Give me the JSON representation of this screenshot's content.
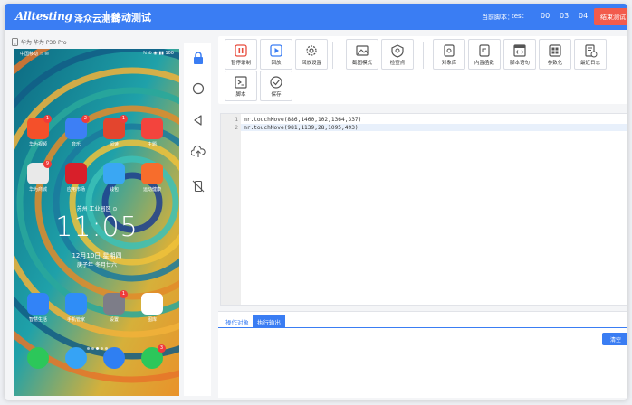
{
  "header": {
    "logo": "Alltesting",
    "logo_sub": "泽众云测试",
    "module": "移动测试",
    "script_label": "当前脚本：",
    "script_name": "test",
    "timer": [
      "00:",
      "03:",
      "04"
    ],
    "end_button": "结束测试"
  },
  "device": {
    "name": "华为 华为 P30 Pro"
  },
  "phone": {
    "status_left": "中国移动 ☆ ✉",
    "status_right": "ℕ ⊘ ◉ ▮▮ 100",
    "apps": [
      {
        "label": "华为视频",
        "badge": "1",
        "color": "#f4502a"
      },
      {
        "label": "音乐",
        "badge": "2",
        "color": "#3d7ff5"
      },
      {
        "label": "阅读",
        "badge": "1",
        "color": "#e3452e"
      },
      {
        "label": "主题",
        "badge": "",
        "color": "#f3443d"
      },
      {
        "label": "华为商城",
        "badge": "9",
        "color": "#e9e9e9"
      },
      {
        "label": "应用市场",
        "badge": "",
        "color": "#d81f2a"
      },
      {
        "label": "钱包",
        "badge": "",
        "color": "#3aa7f3"
      },
      {
        "label": "运动健康",
        "badge": "",
        "color": "#f76d2c"
      },
      {
        "label": "智慧生活",
        "badge": "",
        "color": "#3283f7"
      },
      {
        "label": "手机管家",
        "badge": "",
        "color": "#2f8df7"
      },
      {
        "label": "设置",
        "badge": "1",
        "color": "#7d7d88"
      },
      {
        "label": "图库",
        "badge": "",
        "color": "#ffffff"
      },
      {
        "label": "",
        "badge": "",
        "color": "#2cc75a"
      },
      {
        "label": "",
        "badge": "",
        "color": "#36a3f5"
      },
      {
        "label": "",
        "badge": "",
        "color": "#2f7ff2"
      },
      {
        "label": "",
        "badge": "3",
        "color": "#2cc75a"
      }
    ],
    "clock_location": "苏州 工业园区 ⊙",
    "clock_time": "11:05",
    "clock_date": "12月10日 星期四",
    "clock_lunar": "庚子年 冬月廿六"
  },
  "toolbar": {
    "buttons": [
      {
        "label": "暂停录制",
        "icon": "pause-icon"
      },
      {
        "label": "回放",
        "icon": "play-icon"
      },
      {
        "label": "回放设置",
        "icon": "gear-icon"
      },
      {
        "label": "截图模式",
        "icon": "image-icon"
      },
      {
        "label": "检查点",
        "icon": "checkpoint-icon"
      },
      {
        "label": "对象库",
        "icon": "object-icon"
      },
      {
        "label": "内置函数",
        "icon": "function-icon"
      },
      {
        "label": "脚本语句",
        "icon": "code-icon"
      },
      {
        "label": "参数化",
        "icon": "param-icon"
      },
      {
        "label": "最近日志",
        "icon": "log-icon"
      },
      {
        "label": "脚本",
        "icon": "terminal-icon"
      },
      {
        "label": "保存",
        "icon": "save-icon"
      }
    ]
  },
  "editor": {
    "lines": [
      {
        "no": "1",
        "text": "mr.touchMove(886,1460,102,1364,337)"
      },
      {
        "no": "2",
        "text": "mr.touchMove(981,1139,28,1095,493)"
      }
    ]
  },
  "bottom": {
    "tab_objects": "操作对象",
    "tab_output": "执行输出",
    "clear_button": "清空"
  },
  "colors": {
    "accent": "#3a7df3",
    "danger": "#f25b4c"
  }
}
